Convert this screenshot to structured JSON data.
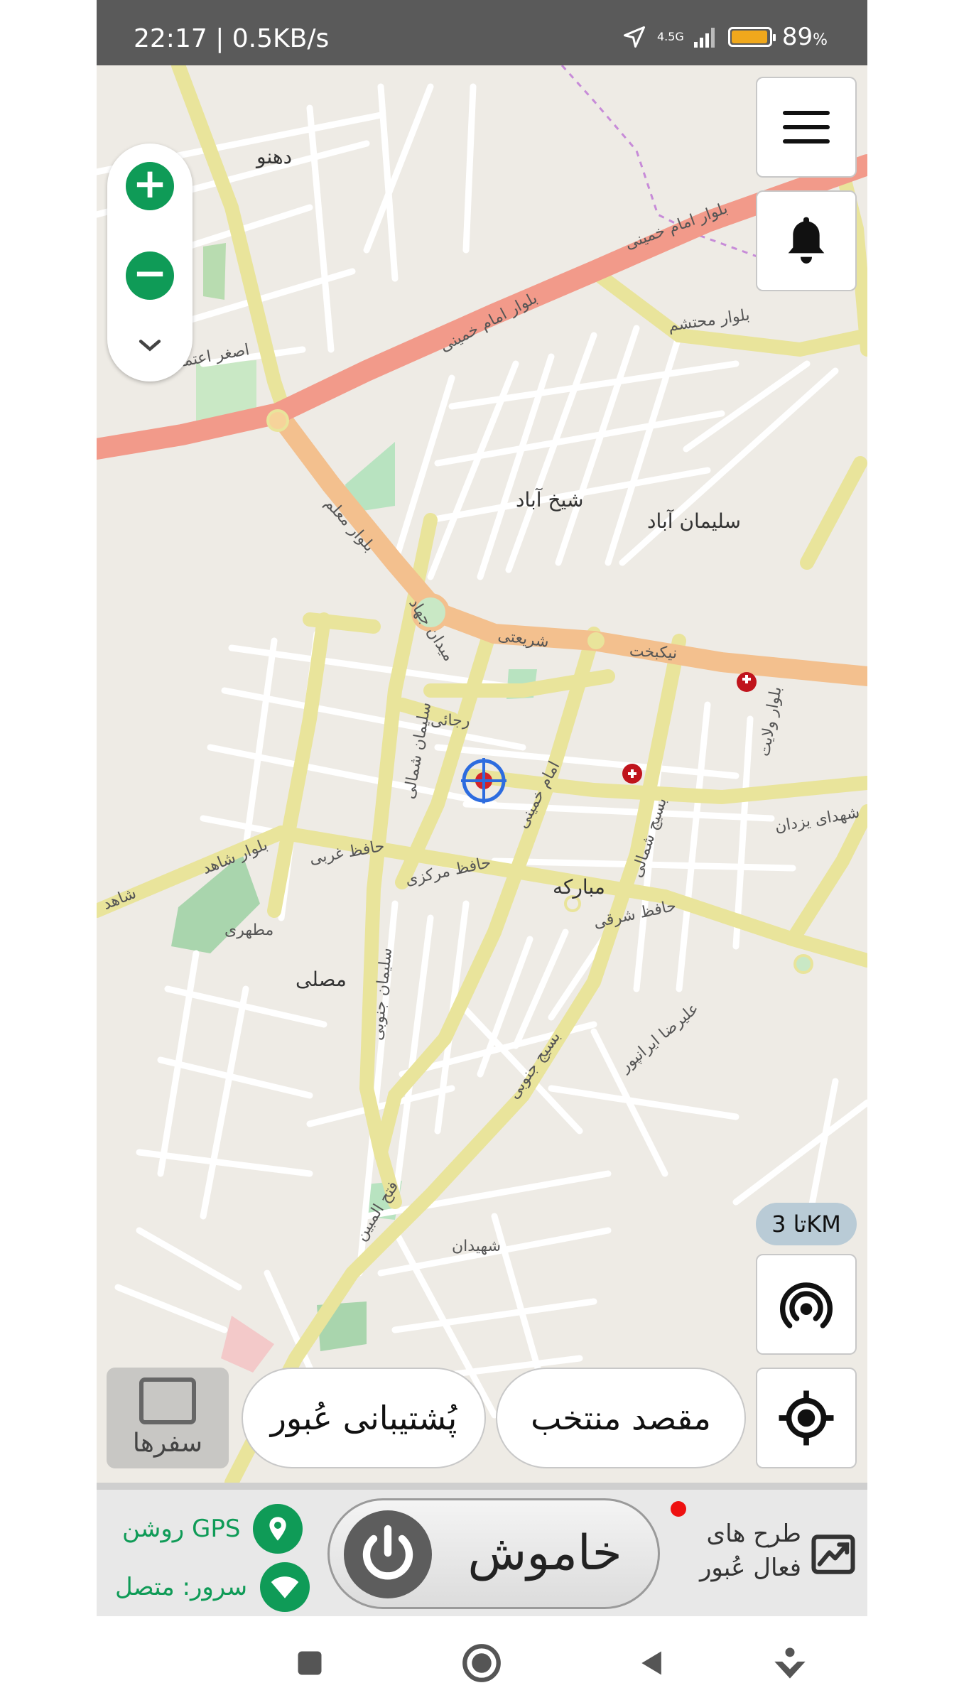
{
  "status_bar": {
    "time": "22:17 | 0.5KB/s",
    "network_type": "4.5G",
    "battery_percent": "89",
    "battery_symbol": "%",
    "battery_level": 0.89,
    "icons": [
      "location-arrow-icon",
      "signal-bars-icon",
      "battery-icon"
    ]
  },
  "map": {
    "labels": {
      "dehno": "دهنو",
      "bolvar_emam_khomeini_1": "بلوار امام خمینی",
      "bolvar_emam_khomeini_2": "بلوار امام خمینی",
      "bolvar_mohtasham": "بلوار محتشم",
      "bolvar_moallem": "بلوار معلم",
      "sheikh_abad": "شیخ آباد",
      "soleyman_abad": "سلیمان آباد",
      "meydan_jahad": "میدان جهاد",
      "shariati": "شریعتی",
      "nikbakht": "نیکبخت",
      "rejaei": "رجائی",
      "emam_khomeini": "امام خمینی",
      "shohada_yazdan": "شهدای یزدان",
      "bolvar_shahed": "بلوار شاهد",
      "hafez_gharbi": "حافظ غربی",
      "hafez_markazi": "حافظ مرکزی",
      "hafez_sharghi": "حافظ شرقی",
      "mobarakeh": "مبارکه",
      "mosalla": "مصلی",
      "soleyman_shomali": "سلیمان شمالی",
      "soleyman_jonubi": "سلیمان جنوبی",
      "basij_shomali": "بسیج شمالی",
      "basij_jonubi": "بسیج جنوبی",
      "fath_almobin": "فتح المبین",
      "shahed": "شاهد",
      "asghar_etemadi": "اصغر اعتمادی",
      "bolvar_velayat": "بلوار ولایت",
      "motahari": "مطهری",
      "alireza_iranpour": "علیرضا ایرانپور",
      "shahidan": "شهیدان"
    }
  },
  "controls": {
    "zoom_in": "+",
    "zoom_out": "−",
    "zoom_more": "⌄",
    "range_badge": "تا 3KM",
    "destination_button": "مقصد منتخب",
    "support_button": "پُشتیبانی عُبور",
    "trips_button": "سفرها"
  },
  "bottom_panel": {
    "power_label": "خاموش",
    "gps_status": "روشن GPS",
    "server_status": "سرور: متصل",
    "plans_label_line1": "طرح های",
    "plans_label_line2": "فعال عُبور",
    "accent_color": "#0f9b57",
    "alert_dot_color": "#e11111"
  },
  "nav_bar": {
    "icons": [
      "square-recent-icon",
      "circle-home-icon",
      "triangle-back-icon",
      "assistant-icon"
    ]
  }
}
